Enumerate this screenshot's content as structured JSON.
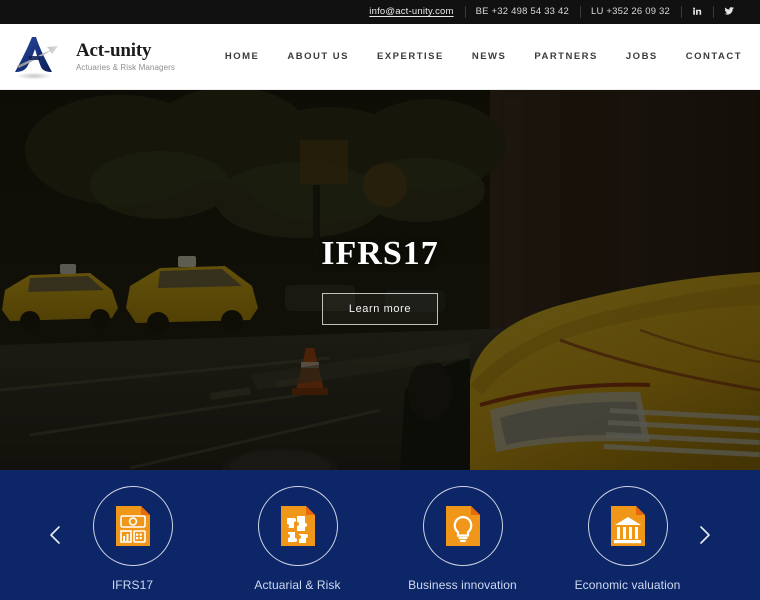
{
  "topbar": {
    "email": "info@act-unity.com",
    "phone_be": "BE +32 498 54 33 42",
    "phone_lu": "LU +352 26 09 32",
    "social": [
      {
        "name": "linkedin-icon",
        "label": "in"
      },
      {
        "name": "twitter-icon",
        "label": "t"
      }
    ]
  },
  "brand": {
    "name": "Act-unity",
    "tagline": "Actuaries & Risk Managers"
  },
  "nav": {
    "items": [
      {
        "label": "HOME"
      },
      {
        "label": "ABOUT US"
      },
      {
        "label": "EXPERTISE"
      },
      {
        "label": "NEWS"
      },
      {
        "label": "PARTNERS"
      },
      {
        "label": "JOBS"
      },
      {
        "label": "CONTACT"
      }
    ]
  },
  "hero": {
    "title": "IFRS17",
    "button_label": "Learn more",
    "image_description": "darkened city street with yellow taxi cabs"
  },
  "services": {
    "prev_label": "‹",
    "next_label": "›",
    "items": [
      {
        "label": "IFRS17",
        "icon": "document-finance-icon"
      },
      {
        "label": "Actuarial & Risk",
        "icon": "document-puzzle-icon"
      },
      {
        "label": "Business innovation",
        "icon": "document-lightbulb-icon"
      },
      {
        "label": "Economic valuation",
        "icon": "document-bank-icon"
      }
    ]
  },
  "colors": {
    "topbar_bg": "#111111",
    "header_bg": "#ffffff",
    "services_bg": "#0c2668",
    "icon_orange": "#f0971a",
    "icon_orange_dark": "#e8690b",
    "brand_blue": "#1f3c8c"
  }
}
